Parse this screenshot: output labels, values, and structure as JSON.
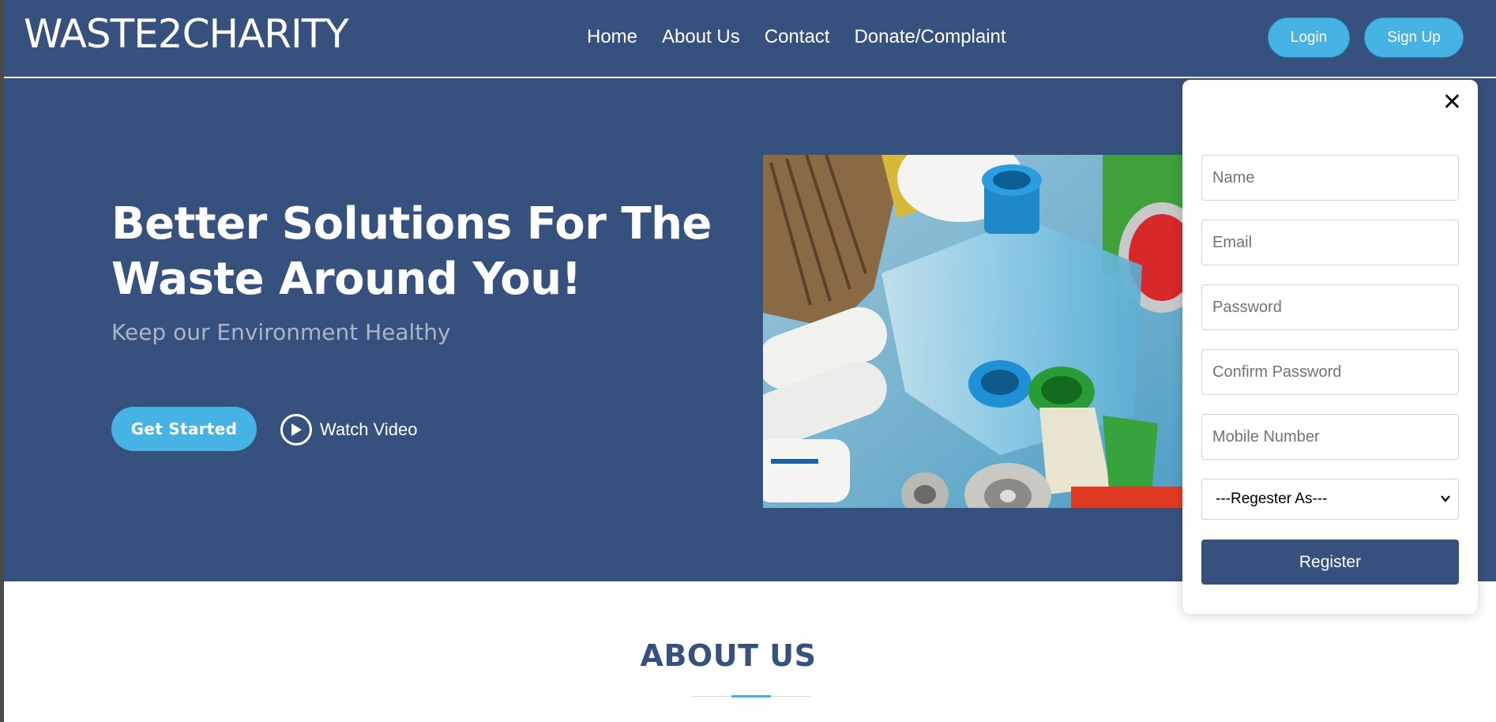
{
  "header": {
    "logo": "WASTE2CHARITY",
    "nav": [
      "Home",
      "About Us",
      "Contact",
      "Donate/Complaint"
    ],
    "login_label": "Login",
    "signup_label": "Sign Up"
  },
  "hero": {
    "title": "Better Solutions For The Waste Around You!",
    "subtitle": "Keep our Environment Healthy",
    "get_started_label": "Get Started",
    "watch_video_label": "Watch Video",
    "image_icon": "recycling-waste-image"
  },
  "about": {
    "title": "ABOUT US"
  },
  "signup_panel": {
    "fields": {
      "name_placeholder": "Name",
      "email_placeholder": "Email",
      "password_placeholder": "Password",
      "confirm_password_placeholder": "Confirm Password",
      "mobile_placeholder": "Mobile Number"
    },
    "register_as_selected": "---Regester As---",
    "register_label": "Register",
    "close_icon": "close-icon"
  },
  "colors": {
    "primary": "#37517e",
    "accent": "#47b2e4",
    "white": "#ffffff",
    "subtitle": "#a9b6cc"
  }
}
